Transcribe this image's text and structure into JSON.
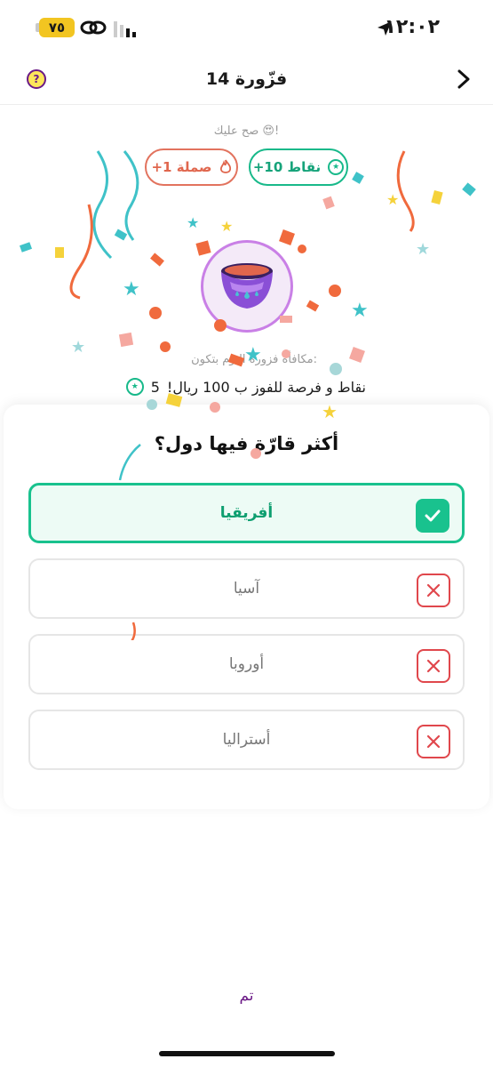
{
  "status_bar": {
    "time": "١٢:٠٢",
    "battery": "٧٥"
  },
  "header": {
    "title": "فزّورة 14"
  },
  "reward": {
    "praise": "صح عليك 😍!",
    "points_pill": "+10 نقاط",
    "streak_pill": "+1 صملة",
    "caption": "مكافأة فزورة اليوم بتكون:",
    "prize_count": "5",
    "prize_text": "نقاط و فرصة للفوز ب 100 ريال!"
  },
  "quiz": {
    "question": "أكثر قارّة فيها دول؟",
    "options": [
      {
        "label": "أفريقيا",
        "state": "correct"
      },
      {
        "label": "آسيا",
        "state": "wrong"
      },
      {
        "label": "أوروبا",
        "state": "wrong"
      },
      {
        "label": "أستراليا",
        "state": "wrong"
      }
    ]
  },
  "footer": {
    "done": "تم"
  },
  "icons": [
    "help-icon",
    "back-chevron-icon",
    "location-arrow-icon",
    "link-icon",
    "signal-icon",
    "star-badge-icon",
    "flame-icon",
    "bowl-icon",
    "check-icon",
    "x-icon"
  ],
  "colors": {
    "accent_green": "#19c28e",
    "accent_purple": "#6b1a86",
    "wrong_red": "#e0474c",
    "streak_orange": "#e0664d"
  }
}
